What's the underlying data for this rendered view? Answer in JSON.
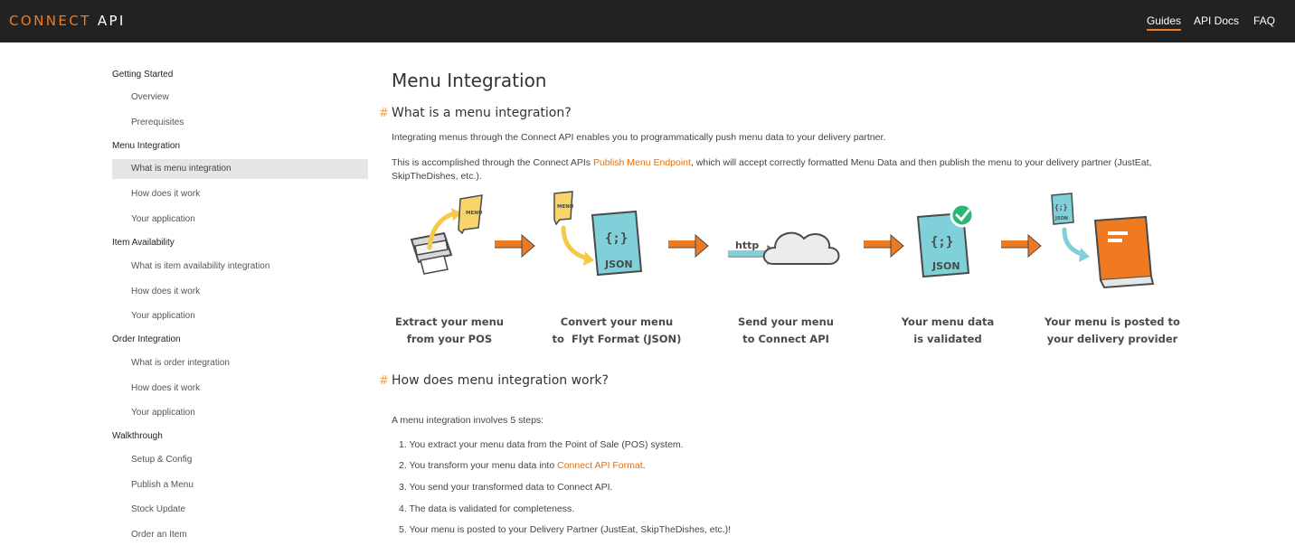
{
  "header": {
    "brand_part1": "CONNECT",
    "brand_part2": "API",
    "nav": [
      {
        "label": "Guides",
        "active": true
      },
      {
        "label": "API Docs",
        "active": false
      },
      {
        "label": "FAQ",
        "active": false
      }
    ]
  },
  "sidebar": {
    "sections": [
      {
        "title": "Getting Started",
        "items": [
          "Overview",
          "Prerequisites"
        ]
      },
      {
        "title": "Menu Integration",
        "items": [
          "What is menu integration",
          "How does it work",
          "Your application"
        ]
      },
      {
        "title": "Item Availability",
        "items": [
          "What is item availability integration",
          "How does it work",
          "Your application"
        ]
      },
      {
        "title": "Order Integration",
        "items": [
          "What is order integration",
          "How does it work",
          "Your application"
        ]
      },
      {
        "title": "Walkthrough",
        "items": [
          "Setup & Config",
          "Publish a Menu",
          "Stock Update",
          "Order an Item"
        ]
      }
    ],
    "active_item": "What is menu integration"
  },
  "main": {
    "title": "Menu Integration",
    "section1": {
      "heading": "What is a menu integration?",
      "hash": "#",
      "para1": "Integrating menus through the Connect API enables you to programmatically push menu data to your delivery partner.",
      "para2_before": "This is accomplished through the Connect APIs ",
      "para2_link": "Publish Menu Endpoint",
      "para2_after": ", which will accept correctly formatted Menu Data and then publish the menu to your delivery partner (JustEat, SkipTheDishes, etc.)."
    },
    "diagram": {
      "steps": [
        {
          "line1": "Extract your menu",
          "line2": "from your POS"
        },
        {
          "line1": "Convert your menu",
          "line2": "to  Flyt Format (JSON)"
        },
        {
          "line1": "Send your menu",
          "line2": "to Connect API"
        },
        {
          "line1": "Your menu data",
          "line2": "is validated"
        },
        {
          "line1": "Your menu is posted to",
          "line2": "your delivery provider"
        }
      ],
      "menu_label": "MENU",
      "json_label": "JSON",
      "json_braces": "{;}",
      "http_label": "http"
    },
    "section2": {
      "heading": "How does menu integration work?",
      "hash": "#",
      "intro": "A menu integration involves 5 steps:",
      "steps": [
        {
          "text": "1. You extract your menu data from the Point of Sale (POS) system."
        },
        {
          "before": "2. You transform your menu data into ",
          "link": "Connect API Format",
          "after": "."
        },
        {
          "text": "3. You send your transformed data to Connect API."
        },
        {
          "text": "4. The data is validated for completeness."
        },
        {
          "text": "5. Your menu is posted to your Delivery Partner (JustEat, SkipTheDishes, etc.)!"
        }
      ]
    }
  },
  "colors": {
    "accent": "#f07a1f",
    "topbar": "#222222",
    "teal": "#7fd0d8",
    "green": "#2bb673"
  }
}
